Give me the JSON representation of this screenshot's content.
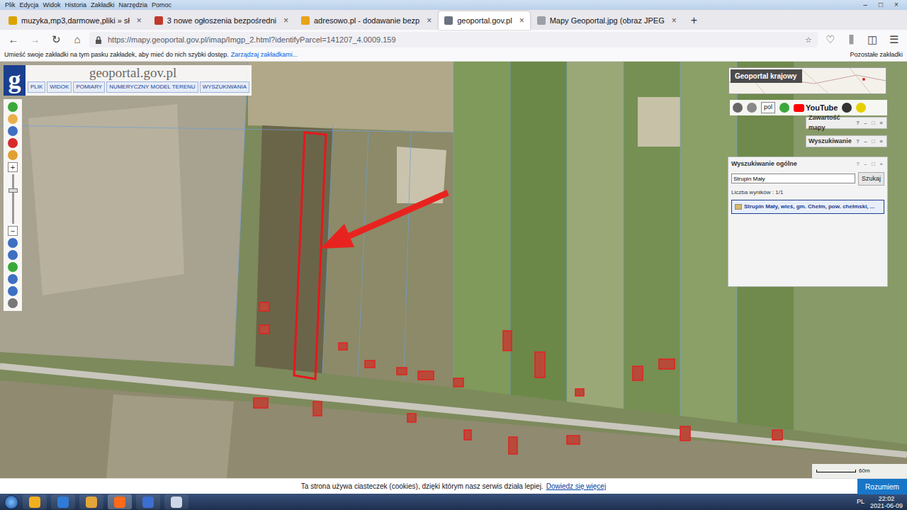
{
  "window": {
    "menu": [
      "Plik",
      "Edycja",
      "Widok",
      "Historia",
      "Zakładki",
      "Narzędzia",
      "Pomoc"
    ],
    "controls": [
      "–",
      "□",
      "×"
    ]
  },
  "tabs": [
    {
      "label": "muzyka,mp3,darmowe,pliki » sł",
      "selected": false,
      "color": "#d9a400"
    },
    {
      "label": "3 nowe ogłoszenia bezpośredni",
      "selected": false,
      "color": "#c0392b"
    },
    {
      "label": "adresowo.pl - dodawanie bezp",
      "selected": false,
      "color": "#e8a317"
    },
    {
      "label": "geoportal.gov.pl",
      "selected": true,
      "color": "#6b7280"
    },
    {
      "label": "Mapy Geoportal.jpg (obraz JPEG",
      "selected": false,
      "color": "#9aa0a6"
    }
  ],
  "tab_close": "×",
  "new_tab": "+",
  "navigation": {
    "buttons": [
      {
        "glyph": "←",
        "disabled": false
      },
      {
        "glyph": "→",
        "disabled": true
      },
      {
        "glyph": "↻",
        "disabled": false
      },
      {
        "glyph": "⌂",
        "disabled": false
      }
    ],
    "url": "https://mapy.geoportal.gov.pl/imap/Imgp_2.html?identifyParcel=141207_4.0009.159",
    "bookmark": "☆",
    "tools": [
      "♡",
      "⫼",
      "◫",
      "☰"
    ]
  },
  "bookmarks_bar": {
    "hint": "Umieść swoje zakładki na tym pasku zakładek, aby mieć do nich szybki dostęp.",
    "link": "Zarządzaj zakładkami...",
    "other": "Pozostałe zakładki"
  },
  "geoportal": {
    "logo_mark": "g",
    "title": "geoportal.gov.pl",
    "menu": [
      "PLIK",
      "WIDOK",
      "POMIARY",
      "NUMERYCZNY MODEL TERENU",
      "WYSZUKIWANIA"
    ],
    "zoom": [
      "+",
      "−"
    ]
  },
  "overview": {
    "title": "Geoportal krajowy"
  },
  "service_bar": {
    "language": "pol",
    "youtube": "YouTube"
  },
  "panels": [
    {
      "title": "Zawartość mapy"
    },
    {
      "title": "Wyszukiwanie"
    }
  ],
  "panel_buttons": [
    "?",
    "–",
    "□",
    "×"
  ],
  "search": {
    "title": "Wyszukiwanie ogólne",
    "value": "Strupin Mały",
    "button": "Szukaj",
    "count": "Liczba wyników : 1/1",
    "results": [
      {
        "label": "Strupin Mały, wieś, gm. Chełm, pow. chełmski, ...",
        "selected": true
      }
    ]
  },
  "map": {
    "scale": "60m"
  },
  "cookie": {
    "text": "Ta strona używa ciasteczek (cookies), dzięki którym nasz serwis działa lepiej.",
    "link": "Dowiedz się więcej",
    "button": "Rozumiem"
  },
  "taskbar": {
    "apps": [
      {
        "color": "#f2b01e",
        "active": false
      },
      {
        "color": "#2f7bd6",
        "active": false
      },
      {
        "color": "#e3a53a",
        "active": false
      },
      {
        "color": "#ff6a1a",
        "active": true
      },
      {
        "color": "#3b6fd1",
        "active": false
      },
      {
        "color": "#cfd8e6",
        "active": false
      }
    ],
    "language": "PL",
    "time": "22:02",
    "date": "2021-06-09"
  }
}
